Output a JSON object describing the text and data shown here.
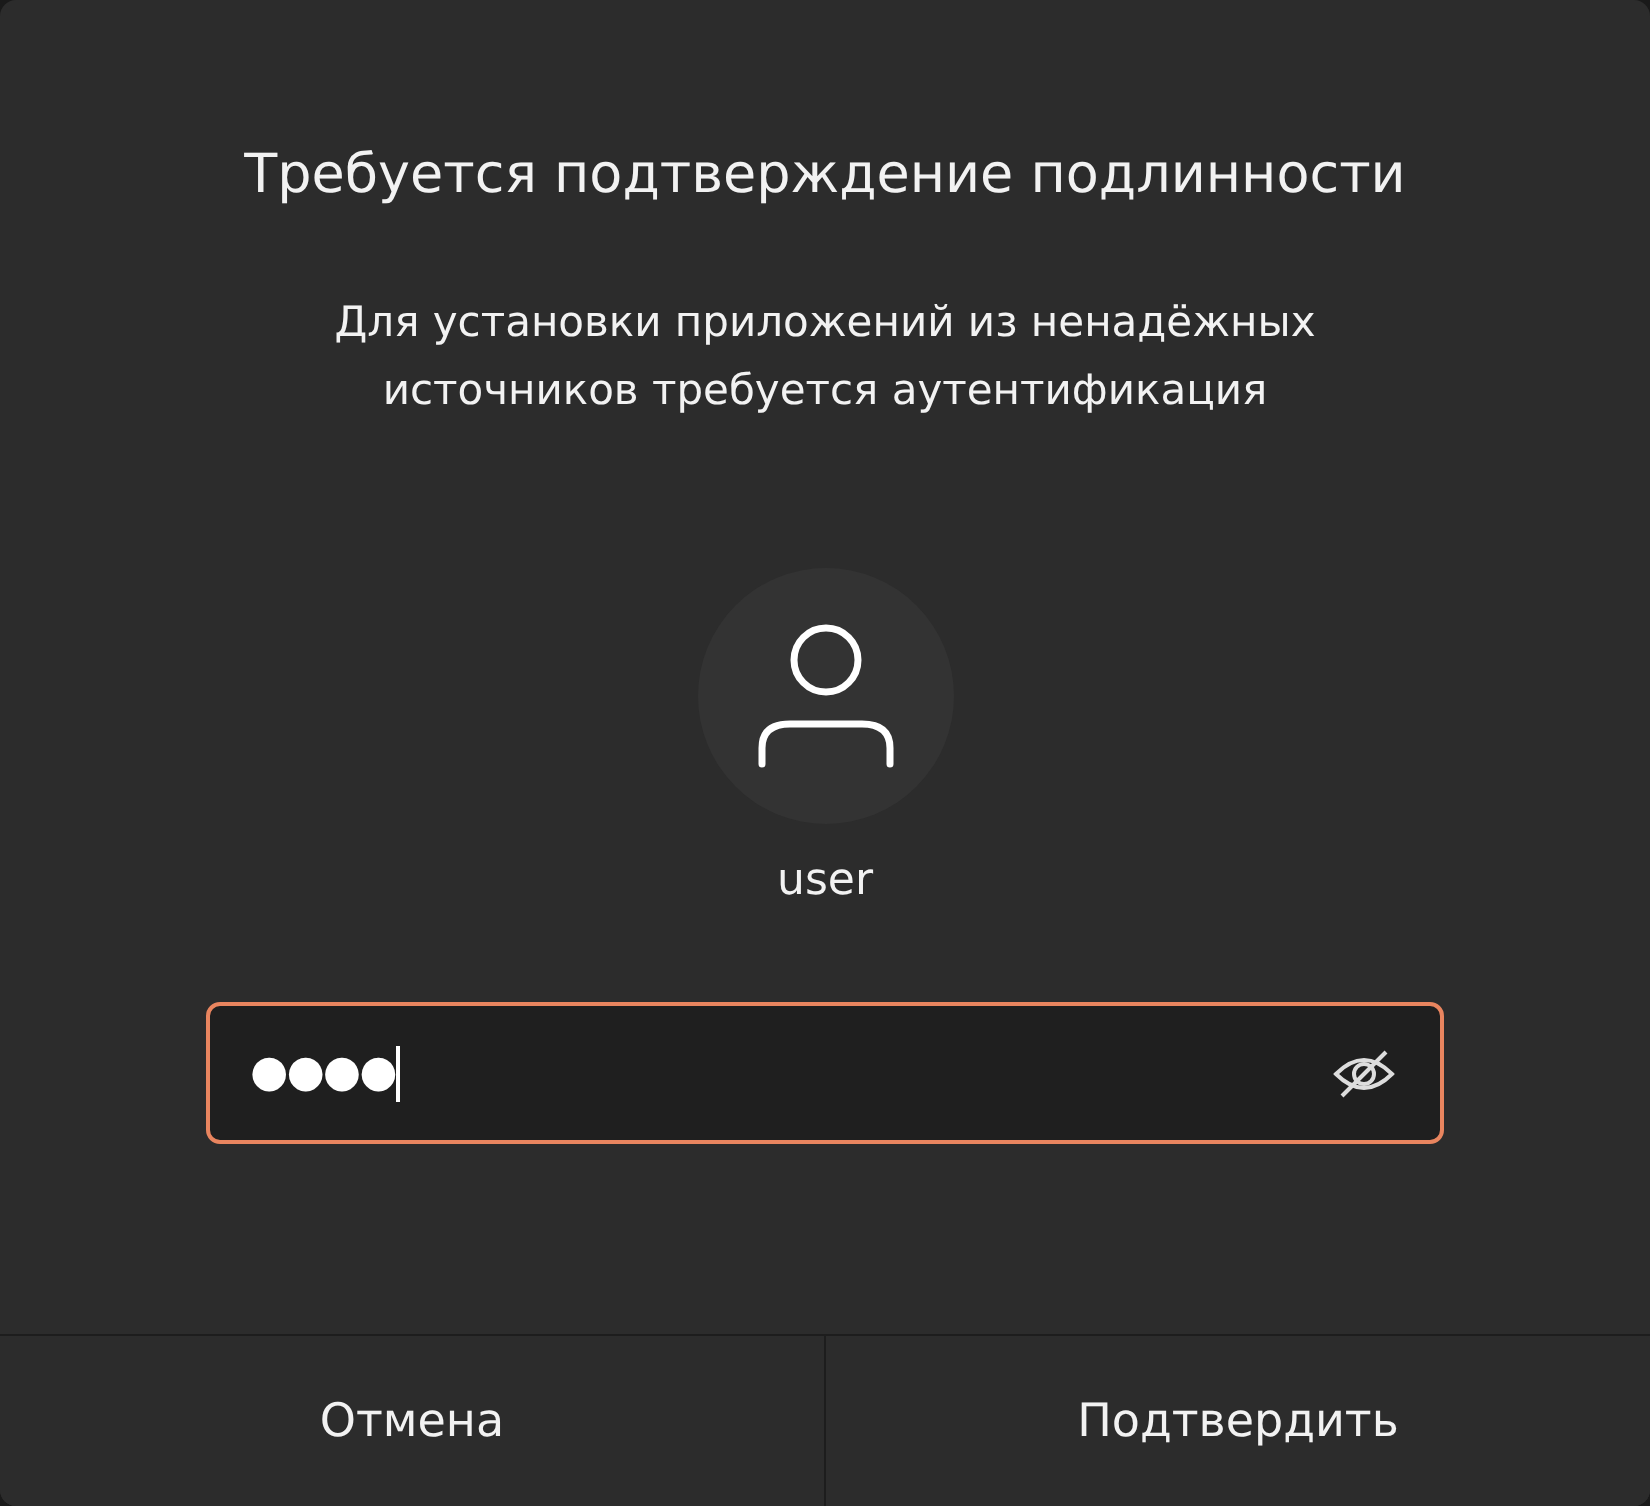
{
  "dialog": {
    "title": "Требуется подтверждение подлинности",
    "message": "Для установки приложений из ненадёжных источников требуется аутентификация"
  },
  "user": {
    "name": "user"
  },
  "password_field": {
    "value": "●●●●",
    "focused": true
  },
  "buttons": [
    {
      "label": "Отмена"
    },
    {
      "label": "Подтвердить"
    }
  ]
}
